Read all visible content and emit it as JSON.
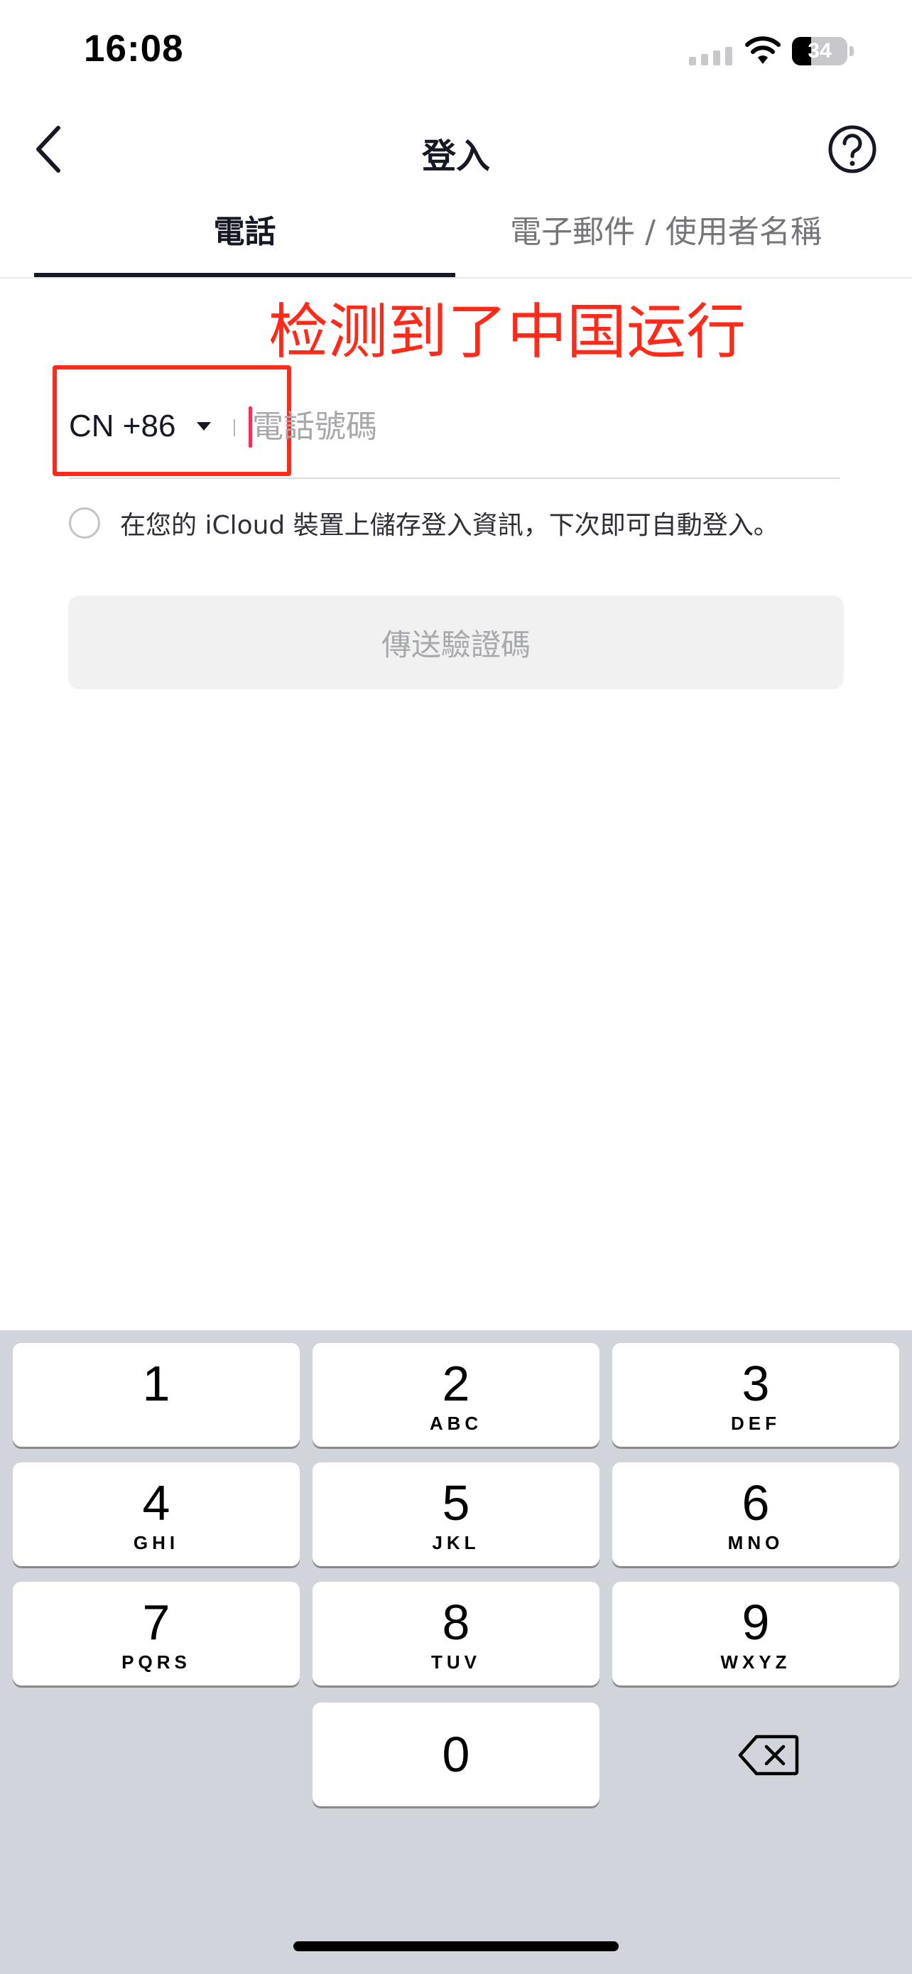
{
  "status_bar": {
    "time": "16:08",
    "battery_level": "34",
    "battery_percent": 34
  },
  "nav": {
    "title": "登入"
  },
  "tabs": [
    {
      "label": "電話",
      "active": true
    },
    {
      "label": "電子郵件 / 使用者名稱",
      "active": false
    }
  ],
  "annotation": {
    "text": "检测到了中国运行",
    "color": "#ff2a1a"
  },
  "phone": {
    "country_code": "CN +86",
    "placeholder": "電話號碼",
    "value": ""
  },
  "remember": {
    "label": "在您的 iCloud 裝置上儲存登入資訊，下次即可自動登入。",
    "checked": false
  },
  "send_button": {
    "label": "傳送驗證碼"
  },
  "keypad": {
    "keys": [
      {
        "digit": "1",
        "letters": ""
      },
      {
        "digit": "2",
        "letters": "ABC"
      },
      {
        "digit": "3",
        "letters": "DEF"
      },
      {
        "digit": "4",
        "letters": "GHI"
      },
      {
        "digit": "5",
        "letters": "JKL"
      },
      {
        "digit": "6",
        "letters": "MNO"
      },
      {
        "digit": "7",
        "letters": "PQRS"
      },
      {
        "digit": "8",
        "letters": "TUV"
      },
      {
        "digit": "9",
        "letters": "WXYZ"
      },
      {
        "digit": "0",
        "letters": ""
      }
    ]
  },
  "icons": {
    "back": "chevron-left-icon",
    "help": "question-circle-icon",
    "caret": "caret-down-icon",
    "delete": "backspace-icon",
    "signal": "cellular-signal-icon",
    "wifi": "wifi-icon",
    "battery": "battery-icon"
  },
  "colors": {
    "accent": "#fe2c55",
    "text": "#161823",
    "disabled_button_bg": "#f1f1f2",
    "keyboard_bg": "#d1d4db"
  }
}
